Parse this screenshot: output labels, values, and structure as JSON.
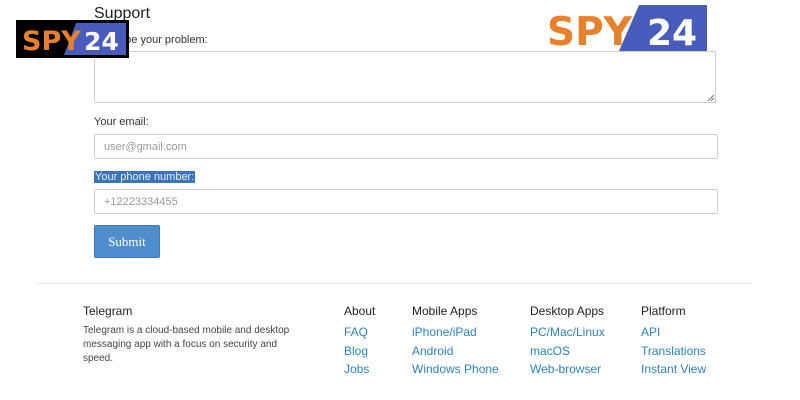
{
  "form": {
    "title": "Support",
    "problem_label": "Describe your problem:",
    "email_label": "Your email:",
    "email_placeholder": "user@gmail.com",
    "phone_label": "Your phone number:",
    "phone_placeholder": "+12223334455",
    "submit_label": "Submit"
  },
  "footer": {
    "telegram": {
      "heading": "Telegram",
      "description": "Telegram is a cloud-based mobile and desktop messaging app with a focus on security and speed."
    },
    "about": {
      "heading": "About",
      "links": [
        "FAQ",
        "Blog",
        "Jobs"
      ]
    },
    "mobile_apps": {
      "heading": "Mobile Apps",
      "links": [
        "iPhone/iPad",
        "Android",
        "Windows Phone"
      ]
    },
    "desktop_apps": {
      "heading": "Desktop Apps",
      "links": [
        "PC/Mac/Linux",
        "macOS",
        "Web-browser"
      ]
    },
    "platform": {
      "heading": "Platform",
      "links": [
        "API",
        "Translations",
        "Instant View"
      ]
    }
  },
  "watermark": {
    "small": {
      "left": "SPY",
      "right": "24"
    },
    "large": {
      "left": "SPY",
      "right": "24"
    }
  },
  "colors": {
    "link": "#2c82bf",
    "button": "#4f8dcd",
    "selection": "#3d73b9",
    "logo_orange": "#e8812c",
    "logo_blue": "#4a5cbb"
  }
}
